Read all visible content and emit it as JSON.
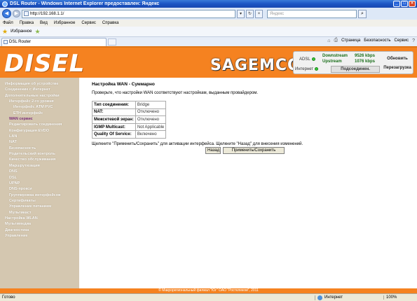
{
  "window": {
    "title": "DSL Router - Windows Internet Explorer предоставлен: Яндекс"
  },
  "address": {
    "url": "http://192.168.1.1/",
    "search_placeholder": "Яндекс"
  },
  "menu": [
    "Файл",
    "Правка",
    "Вид",
    "Избранное",
    "Сервис",
    "Справка"
  ],
  "favorites": {
    "label": "Избранное"
  },
  "tab": {
    "title": "DSL Router"
  },
  "commands": {
    "page": "Страница",
    "safety": "Безопасность",
    "tools": "Сервис"
  },
  "banner": {
    "logo": "DISEL",
    "brand": "SAGEMCOM",
    "adsl_label": "ADSL",
    "downstream_label": "Downstream",
    "upstream_label": "Upstream",
    "downstream_value": "9526 kbps",
    "upstream_value": "1076 kbps",
    "internet_label": "Интернет",
    "connection_status": "Подсоединен.",
    "refresh_button": "Обновить",
    "reboot_button": "Перезагрузка"
  },
  "sidebar": [
    {
      "label": "Информация об устройстве",
      "level": 0
    },
    {
      "label": "Соединение с Интернет",
      "level": 0
    },
    {
      "label": "Дополнительные настройки",
      "level": 0
    },
    {
      "label": "Интерфейс 2-го уровня",
      "level": 1
    },
    {
      "label": "Интерфейс ATM PVC",
      "level": 2
    },
    {
      "label": "ETH интерфейс",
      "level": 2
    },
    {
      "label": "WAN сервис",
      "level": 1,
      "selected": true
    },
    {
      "label": "Редактировать соединения",
      "level": 1
    },
    {
      "label": "Конфигурация EVDO",
      "level": 1
    },
    {
      "label": "LAN",
      "level": 1
    },
    {
      "label": "NAT",
      "level": 1
    },
    {
      "label": "Безопасность",
      "level": 1
    },
    {
      "label": "Родительский контроль",
      "level": 1
    },
    {
      "label": "Качество обслуживания",
      "level": 1
    },
    {
      "label": "Маршрутизация",
      "level": 1
    },
    {
      "label": "DNS",
      "level": 1
    },
    {
      "label": "DSL",
      "level": 1
    },
    {
      "label": "UPNP",
      "level": 1
    },
    {
      "label": "DNS-прокси",
      "level": 1
    },
    {
      "label": "Группировка интерфейсов",
      "level": 1
    },
    {
      "label": "Сертификаты",
      "level": 1
    },
    {
      "label": "Управление питанием",
      "level": 1
    },
    {
      "label": "Мультикаст",
      "level": 1
    },
    {
      "label": "Настройка WLAN",
      "level": 0
    },
    {
      "label": "Мультимедиа",
      "level": 0
    },
    {
      "label": "Диагностика",
      "level": 0
    },
    {
      "label": "Управление",
      "level": 0
    }
  ],
  "content": {
    "title": "Настройка WAN - Суммарно",
    "description": "Проверьте, что настройки WAN соответствуют настройкам, выданным провайдером.",
    "summary": [
      {
        "key": "Тип соединения:",
        "value": "Bridge"
      },
      {
        "key": "NAT:",
        "value": "Отключено"
      },
      {
        "key": "Межсетевой экран:",
        "value": "Отключено"
      },
      {
        "key": "IGMP Multicast:",
        "value": "Not Applicable"
      },
      {
        "key": "Quality Of Service:",
        "value": "Включено"
      }
    ],
    "hint": "Щелкните \"Применить/Сохранить\" для активации интерфейса. Щелкните \"Назад\" для внесения изменений.",
    "back_button": "Назад",
    "apply_button": "Применить/Сохранить"
  },
  "footer": "© Макрорегиональный филиал \"Юг\" ОАО \"Ростелеком\", 2011",
  "statusbar": {
    "ready": "Готово",
    "zone": "Интернет",
    "zoom": "100%"
  }
}
